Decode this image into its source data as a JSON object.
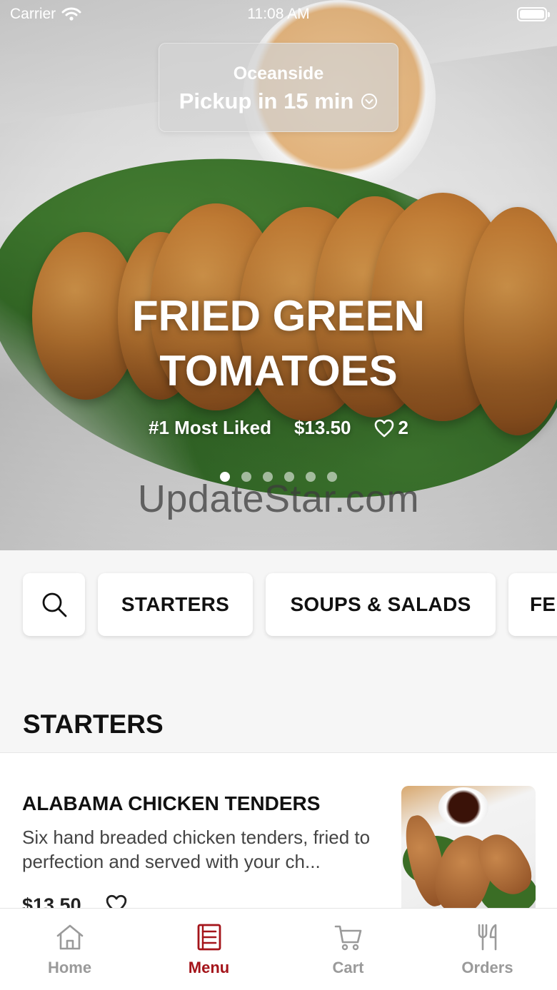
{
  "status_bar": {
    "carrier": "Carrier",
    "time": "11:08 AM"
  },
  "location": {
    "name": "Oceanside",
    "pickup": "Pickup in 15 min"
  },
  "featured": {
    "title_line1": "FRIED GREEN",
    "title_line2": "TOMATOES",
    "badge": "#1 Most Liked",
    "price": "$13.50",
    "likes": "2",
    "carousel": {
      "count": 6,
      "active_index": 0
    }
  },
  "watermark": "UpdateStar.com",
  "categories": [
    {
      "label": "STARTERS"
    },
    {
      "label": "SOUPS & SALADS"
    },
    {
      "label": "FE"
    }
  ],
  "section_title": "STARTERS",
  "menu_item": {
    "name": "ALABAMA CHICKEN TENDERS",
    "description": "Six hand breaded chicken tenders, fried to perfection and served with your ch...",
    "price": "$13.50"
  },
  "tabs": [
    {
      "label": "Home",
      "icon": "home-icon",
      "active": false
    },
    {
      "label": "Menu",
      "icon": "menu-icon",
      "active": true
    },
    {
      "label": "Cart",
      "icon": "cart-icon",
      "active": false
    },
    {
      "label": "Orders",
      "icon": "utensils-icon",
      "active": false
    }
  ],
  "colors": {
    "accent": "#a4141a",
    "inactive_tab": "#9a9a9a"
  }
}
